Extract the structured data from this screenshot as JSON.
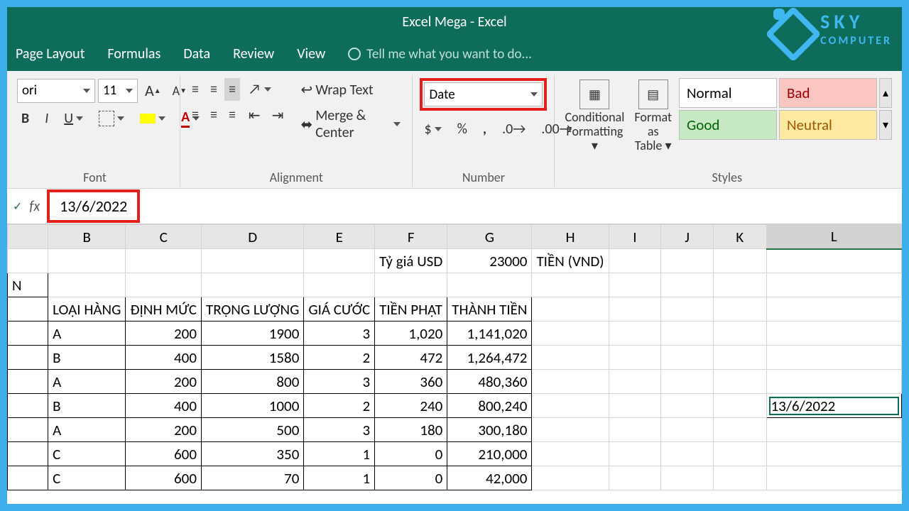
{
  "title": "Excel Mega - Excel",
  "watermark": {
    "brand": "SKY",
    "sub": "COMPUTER"
  },
  "tabs": {
    "page_layout": "Page Layout",
    "formulas": "Formulas",
    "data": "Data",
    "review": "Review",
    "view": "View",
    "tellme": "Tell me what you want to do..."
  },
  "font_group": {
    "label": "Font",
    "font_name": "ori",
    "font_size": "11",
    "bold": "B",
    "italic": "I",
    "underline": "U",
    "font_color_letter": "A"
  },
  "alignment_group": {
    "label": "Alignment",
    "wrap": "Wrap Text",
    "merge": "Merge & Center"
  },
  "number_group": {
    "label": "Number",
    "format": "Date",
    "currency": "$",
    "percent": "%",
    "comma": ","
  },
  "styles_group": {
    "label": "Styles",
    "cond": "Conditional Formatting",
    "fat": "Format as Table",
    "normal": "Normal",
    "bad": "Bad",
    "good": "Good",
    "neutral": "Neutral"
  },
  "formula_bar": {
    "fx": "fx",
    "value": "13/6/2022",
    "check": "✓"
  },
  "columns": [
    "",
    "B",
    "C",
    "D",
    "E",
    "F",
    "G",
    "H",
    "I",
    "J",
    "K",
    "L"
  ],
  "row1": {
    "F": "Tỷ giá USD",
    "G": "23000",
    "H": "TIỀN (VND)"
  },
  "row2_A": "N",
  "headers": {
    "B": "LOẠI HÀNG",
    "C": "ĐỊNH MỨC",
    "D": "TRỌNG LƯỢNG",
    "E": "GIÁ CƯỚC",
    "F": "TIỀN PHẠT",
    "G": "THÀNH TIỀN"
  },
  "rows": [
    {
      "B": "A",
      "C": "200",
      "D": "1900",
      "E": "3",
      "F": "1,020",
      "G": "1,141,020"
    },
    {
      "B": "B",
      "C": "400",
      "D": "1580",
      "E": "2",
      "F": "472",
      "G": "1,264,472"
    },
    {
      "B": "A",
      "C": "200",
      "D": "800",
      "E": "3",
      "F": "360",
      "G": "480,360"
    },
    {
      "B": "B",
      "C": "400",
      "D": "1000",
      "E": "2",
      "F": "240",
      "G": "800,240"
    },
    {
      "B": "A",
      "C": "200",
      "D": "500",
      "E": "3",
      "F": "180",
      "G": "300,180"
    },
    {
      "B": "C",
      "C": "600",
      "D": "350",
      "E": "1",
      "F": "0",
      "G": "210,000"
    },
    {
      "B": "C",
      "C": "600",
      "D": "70",
      "E": "1",
      "F": "0",
      "G": "42,000"
    }
  ],
  "selected_cell_value": "13/6/2022"
}
